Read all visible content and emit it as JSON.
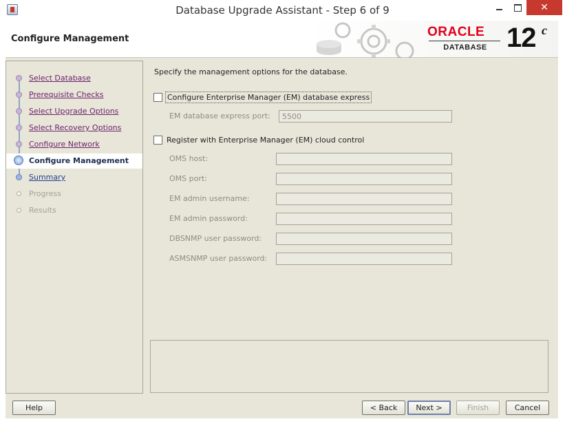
{
  "window": {
    "title": "Database Upgrade Assistant - Step 6 of 9",
    "close_glyph": "✕"
  },
  "header": {
    "title": "Configure Management",
    "brand": "ORACLE",
    "product": "DATABASE",
    "version": "12",
    "version_suffix": "c"
  },
  "steps": [
    {
      "label": "Select Database",
      "state": "visited"
    },
    {
      "label": "Prerequisite Checks",
      "state": "visited"
    },
    {
      "label": "Select Upgrade Options",
      "state": "visited"
    },
    {
      "label": "Select Recovery Options",
      "state": "visited"
    },
    {
      "label": "Configure Network",
      "state": "visited"
    },
    {
      "label": "Configure Management",
      "state": "current"
    },
    {
      "label": "Summary",
      "state": "next"
    },
    {
      "label": "Progress",
      "state": "disabled"
    },
    {
      "label": "Results",
      "state": "disabled"
    }
  ],
  "content": {
    "intro": "Specify the management options for the database.",
    "em_express": {
      "label": "Configure Enterprise Manager (EM) database express",
      "checked": false,
      "port_label": "EM database express port:",
      "port_value": "5500"
    },
    "cloud_control": {
      "label": "Register with Enterprise Manager (EM) cloud control",
      "checked": false,
      "fields": [
        {
          "label": "OMS host:",
          "value": ""
        },
        {
          "label": "OMS port:",
          "value": ""
        },
        {
          "label": "EM admin username:",
          "value": ""
        },
        {
          "label": "EM admin password:",
          "value": ""
        },
        {
          "label": "DBSNMP user password:",
          "value": ""
        },
        {
          "label": "ASMSNMP user password:",
          "value": ""
        }
      ]
    }
  },
  "buttons": {
    "help": "Help",
    "back": "< Back",
    "next": "Next >",
    "finish": "Finish",
    "cancel": "Cancel"
  },
  "colors": {
    "oracle_red": "#e2001a",
    "panel_bg": "#e8e6d9",
    "visited_link": "#6b1f6b",
    "next_link": "#1f3f8f"
  }
}
